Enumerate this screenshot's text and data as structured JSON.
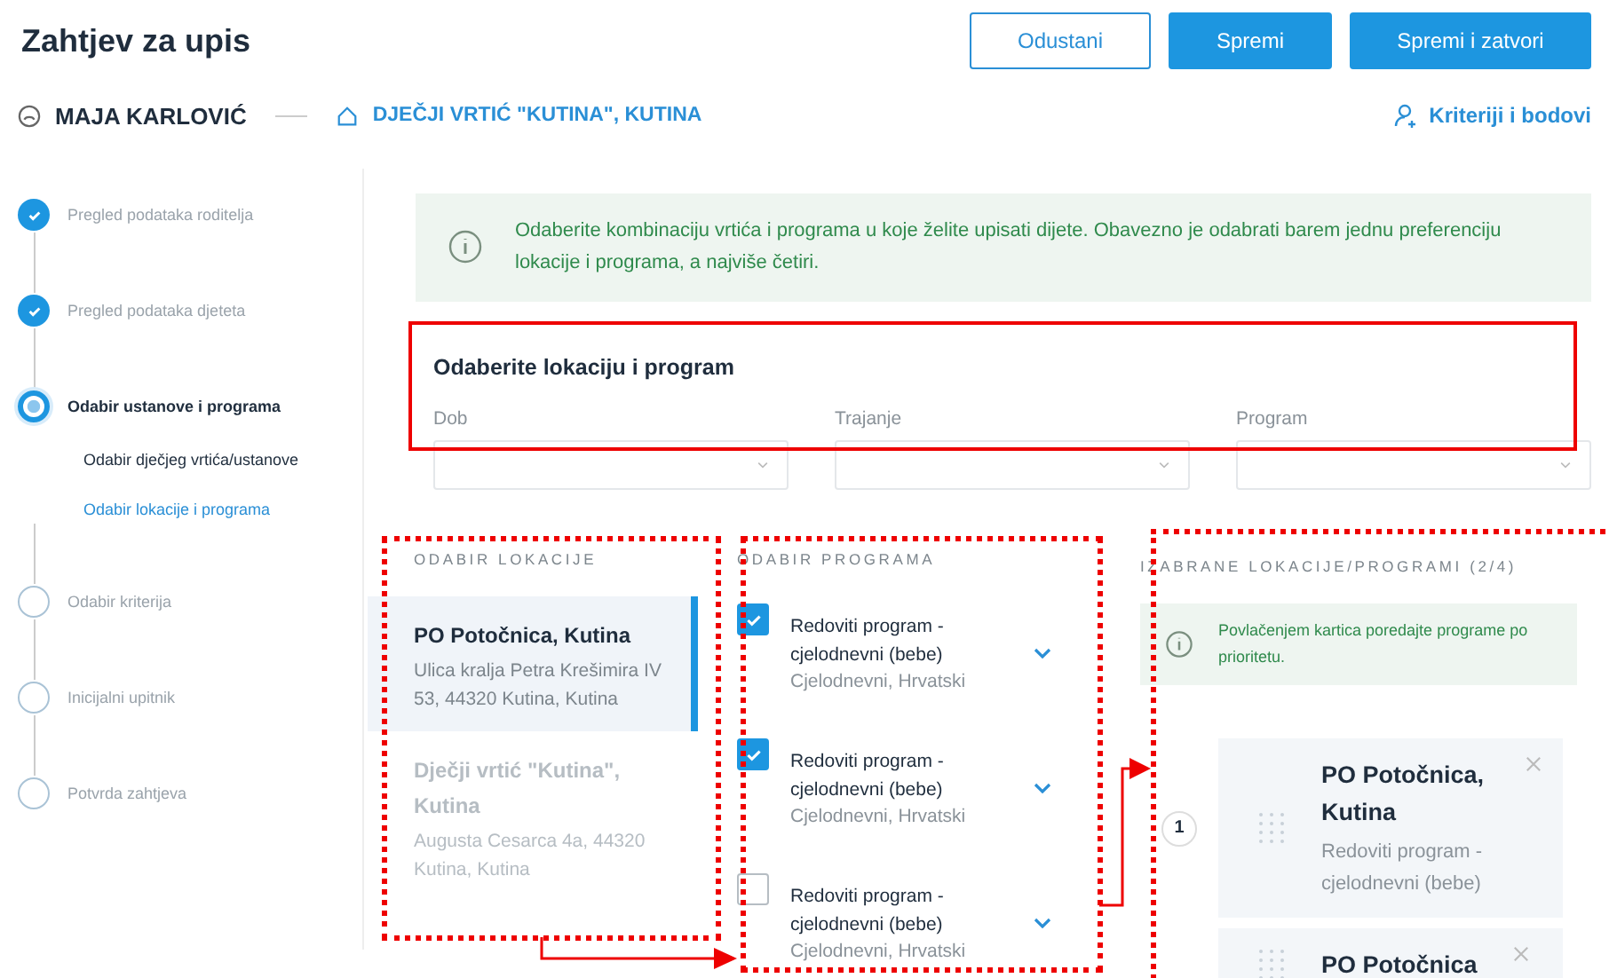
{
  "header": {
    "title": "Zahtjev za upis",
    "buttons": [
      {
        "label": "Odustani",
        "kind": "outline"
      },
      {
        "label": "Spremi",
        "kind": "primary"
      },
      {
        "label": "Spremi i zatvori",
        "kind": "primary"
      }
    ]
  },
  "context": {
    "person": "MAJA KARLOVIĆ",
    "institution": "DJEČJI VRTIĆ \"KUTINA\", KUTINA",
    "criteria_link": "Kriteriji i bodovi"
  },
  "steps": [
    {
      "label": "Pregled podataka roditelja",
      "done": true,
      "current": false
    },
    {
      "label": "Pregled podataka djeteta",
      "done": true,
      "current": false
    },
    {
      "label": "Odabir ustanove i programa",
      "done": false,
      "current": true,
      "children": [
        {
          "label": "Odabir dječjeg vrtića/ustanove",
          "selected": false
        },
        {
          "label": "Odabir lokacije i programa",
          "selected": true
        }
      ]
    },
    {
      "label": "Odabir kriterija",
      "done": false,
      "current": false
    },
    {
      "label": "Inicijalni upitnik",
      "done": false,
      "current": false
    },
    {
      "label": "Potvrda zahtjeva",
      "done": false,
      "current": false
    }
  ],
  "info": "Odaberite kombinaciju vrtića i programa u koje želite upisati dijete. Obavezno je odabrati barem jednu preferenciju lokacije i programa, a najviše četiri.",
  "section_title": "Odaberite lokaciju i program",
  "filters": [
    {
      "label": "Dob"
    },
    {
      "label": "Trajanje"
    },
    {
      "label": "Program"
    }
  ],
  "locations": {
    "title": "ODABIR LOKACIJE",
    "items": [
      {
        "name": "PO Potočnica, Kutina",
        "address": "Ulica kralja Petra Krešimira IV 53, 44320 Kutina, Kutina",
        "selected": true
      },
      {
        "name": "Dječji vrtić \"Kutina\", Kutina",
        "address": "Augusta Cesarca 4a, 44320 Kutina, Kutina",
        "selected": false
      }
    ]
  },
  "programs": {
    "title": "ODABIR PROGRAMA",
    "items": [
      {
        "title": "Redoviti program - cjelodnevni (bebe)",
        "subtitle": "Cjelodnevni, Hrvatski",
        "checked": true
      },
      {
        "title": "Redoviti program - cjelodnevni (bebe)",
        "subtitle": "Cjelodnevni, Hrvatski",
        "checked": true
      },
      {
        "title": "Redoviti program - cjelodnevni (bebe)",
        "subtitle": "Cjelodnevni, Hrvatski",
        "checked": false
      }
    ]
  },
  "chosen": {
    "title": "IZABRANE LOKACIJE/PROGRAMI (2/4)",
    "hint": "Povlačenjem kartica poredajte programe po prioritetu.",
    "cards": [
      {
        "number": "1",
        "name": "PO Potočnica, Kutina",
        "program": "Redoviti program - cjelodnevni (bebe)"
      },
      {
        "name": "PO Potočnica"
      }
    ]
  }
}
